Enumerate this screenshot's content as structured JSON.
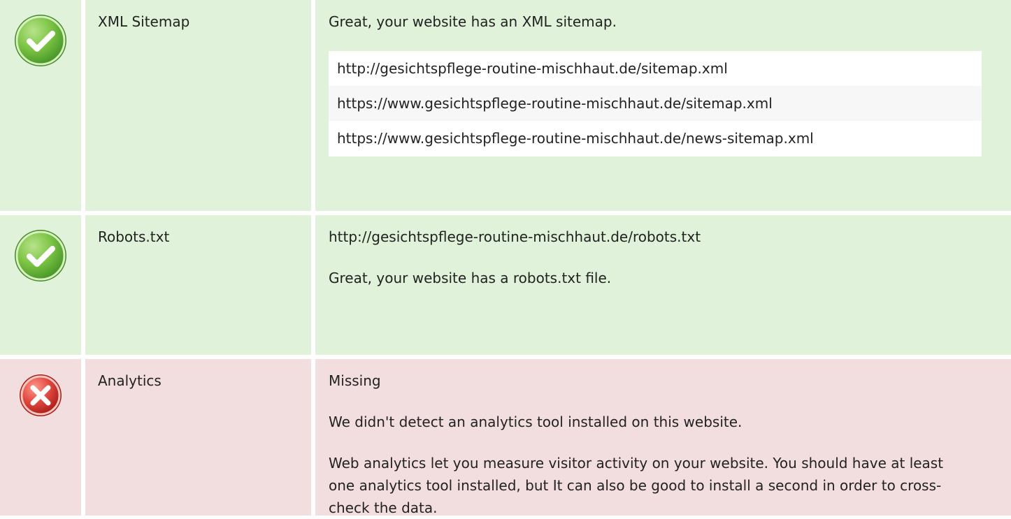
{
  "colors": {
    "pass_background": "#e0f2d9",
    "fail_background": "#f3dedf",
    "pass_icon": "#6fbf3b",
    "fail_icon": "#d83a3a"
  },
  "sitemap": {
    "status_icon": "check-icon",
    "title": "XML Sitemap",
    "message": "Great, your website has an XML sitemap.",
    "urls": [
      "http://gesichtspflege-routine-mischhaut.de/sitemap.xml",
      "https://www.gesichtspflege-routine-mischhaut.de/sitemap.xml",
      "https://www.gesichtspflege-routine-mischhaut.de/news-sitemap.xml"
    ]
  },
  "robots": {
    "status_icon": "check-icon",
    "title": "Robots.txt",
    "url": "http://gesichtspflege-routine-mischhaut.de/robots.txt",
    "message": "Great, your website has a robots.txt file."
  },
  "analytics": {
    "status_icon": "close-icon",
    "title": "Analytics",
    "status": "Missing",
    "message": "We didn't detect an analytics tool installed on this website.",
    "description": "Web analytics let you measure visitor activity on your website. You should have at least one analytics tool installed, but It can also be good to install a second in order to cross-check the data."
  }
}
